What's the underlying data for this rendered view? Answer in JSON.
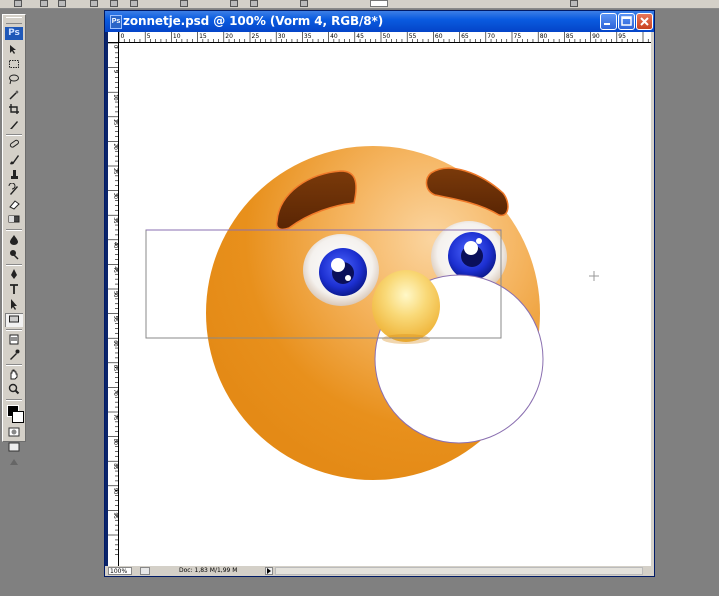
{
  "app": {
    "logo_text": "Ps"
  },
  "document": {
    "title": "zonnetje.psd @ 100% (Vorm 4, RGB/8*)",
    "zoom": "100%",
    "doc_info": "Doc: 1,83 M/1,99 M",
    "ruler_top_labels": [
      "0",
      "5",
      "10",
      "15",
      "20",
      "25",
      "30",
      "35",
      "40",
      "45",
      "50",
      "55",
      "60",
      "65",
      "70",
      "75",
      "80",
      "85",
      "90",
      "95"
    ],
    "ruler_left_labels": [
      "0",
      "5",
      "10",
      "15",
      "20",
      "25",
      "30",
      "35",
      "40",
      "45",
      "50",
      "55",
      "60",
      "65",
      "70",
      "75",
      "80",
      "85",
      "90",
      "95"
    ]
  },
  "tools": [
    "move-tool",
    "marquee-tool",
    "lasso-tool",
    "magic-wand-tool",
    "crop-tool",
    "slice-tool",
    "healing-brush-tool",
    "brush-tool",
    "clone-stamp-tool",
    "history-brush-tool",
    "eraser-tool",
    "gradient-tool",
    "blur-tool",
    "dodge-tool",
    "pen-tool",
    "type-tool",
    "path-selection-tool",
    "shape-tool",
    "notes-tool",
    "eyedropper-tool",
    "hand-tool",
    "zoom-tool"
  ],
  "colors": {
    "face": "#e8901c",
    "face_highlight": "#fbd29a",
    "eyebrow": "#6a2e06",
    "iris": "#1c2fd0",
    "nose": "#f7d470",
    "selection_box": "#8a8a8a",
    "path_outline": "#8a6fb0"
  }
}
